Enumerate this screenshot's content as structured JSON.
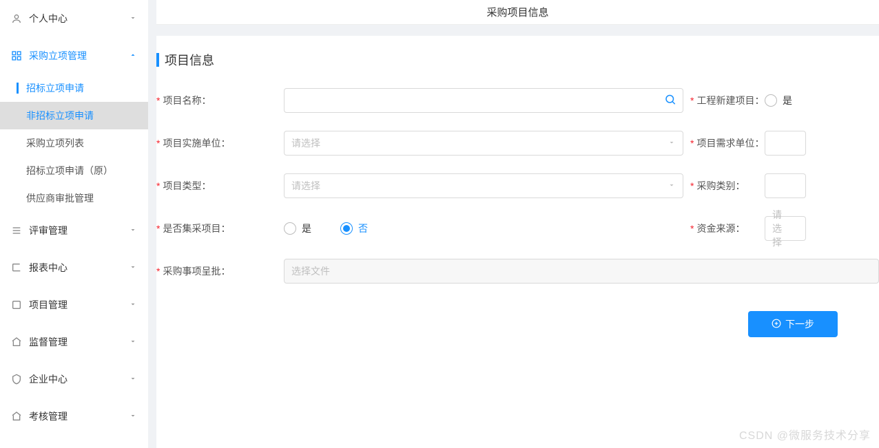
{
  "sidebar": {
    "items": [
      {
        "icon": "user",
        "label": "个人中心",
        "expanded": false
      },
      {
        "icon": "app",
        "label": "采购立项管理",
        "expanded": true,
        "sub": [
          {
            "label": "招标立项申请",
            "active": true
          },
          {
            "label": "非招标立项申请",
            "selected": true
          },
          {
            "label": "采购立项列表"
          },
          {
            "label": "招标立项申请（原）"
          },
          {
            "label": "供应商审批管理"
          }
        ]
      },
      {
        "icon": "review",
        "label": "评审管理",
        "expanded": false
      },
      {
        "icon": "report",
        "label": "报表中心",
        "expanded": false
      },
      {
        "icon": "project",
        "label": "项目管理",
        "expanded": false
      },
      {
        "icon": "monitor",
        "label": "监督管理",
        "expanded": false
      },
      {
        "icon": "enterprise",
        "label": "企业中心",
        "expanded": false
      },
      {
        "icon": "assess",
        "label": "考核管理",
        "expanded": false
      }
    ]
  },
  "page": {
    "title": "采购项目信息"
  },
  "section": {
    "title": "项目信息"
  },
  "form": {
    "project_name_label": "项目名称：",
    "project_name_value": "",
    "new_construct_label": "工程新建项目：",
    "radio_yes": "是",
    "radio_no": "否",
    "impl_unit_label": "项目实施单位：",
    "impl_unit_placeholder": "请选择",
    "demand_unit_label": "项目需求单位：",
    "project_type_label": "项目类型：",
    "project_type_placeholder": "请选择",
    "purchase_cat_label": "采购类别：",
    "is_collective_label": "是否集采项目：",
    "fund_source_label": "资金来源：",
    "fund_source_placeholder": "请选择",
    "approval_label": "采购事项呈批：",
    "approval_placeholder": "选择文件"
  },
  "button": {
    "next": "下一步"
  },
  "watermark": "CSDN @微服务技术分享"
}
